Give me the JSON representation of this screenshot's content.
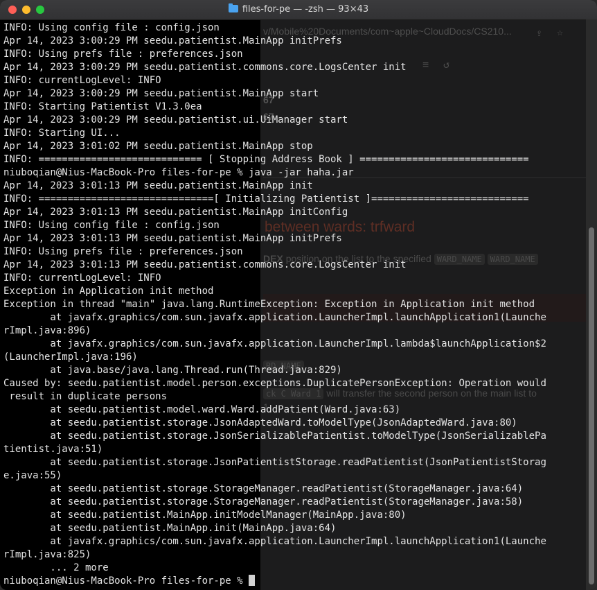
{
  "window": {
    "title": "files-for-pe — -zsh — 93×43"
  },
  "background_window": {
    "url_fragment": "v/Mobile%20Documents/com~apple~CloudDocs/CS210...",
    "number_1": "67",
    "number_2": "67",
    "heading": "between wards: trfward",
    "body_1_prefix": "DEX",
    "body_1_text": "position on the list to the specified",
    "code_1": "WARD_NAME",
    "code_2": "WARD_NAME",
    "code_3": "RD_NAME",
    "code_4": "ck C Ward 1",
    "body_2_text": "will transfer the second person on the main list to",
    "body_3_text": "1"
  },
  "terminal": {
    "lines": [
      "INFO: Using config file : config.json",
      "Apr 14, 2023 3:00:29 PM seedu.patientist.MainApp initPrefs",
      "INFO: Using prefs file : preferences.json",
      "Apr 14, 2023 3:00:29 PM seedu.patientist.commons.core.LogsCenter init",
      "INFO: currentLogLevel: INFO",
      "Apr 14, 2023 3:00:29 PM seedu.patientist.MainApp start",
      "INFO: Starting Patientist V1.3.0ea",
      "Apr 14, 2023 3:00:29 PM seedu.patientist.ui.UiManager start",
      "INFO: Starting UI...",
      "Apr 14, 2023 3:01:02 PM seedu.patientist.MainApp stop",
      "INFO: ============================ [ Stopping Address Book ] =============================",
      "niuboqian@Nius-MacBook-Pro files-for-pe % java -jar haha.jar",
      "Apr 14, 2023 3:01:13 PM seedu.patientist.MainApp init",
      "INFO: ==============================[ Initializing Patientist ]===========================",
      "Apr 14, 2023 3:01:13 PM seedu.patientist.MainApp initConfig",
      "INFO: Using config file : config.json",
      "Apr 14, 2023 3:01:13 PM seedu.patientist.MainApp initPrefs",
      "INFO: Using prefs file : preferences.json",
      "Apr 14, 2023 3:01:13 PM seedu.patientist.commons.core.LogsCenter init",
      "INFO: currentLogLevel: INFO",
      "Exception in Application init method",
      "Exception in thread \"main\" java.lang.RuntimeException: Exception in Application init method",
      "        at javafx.graphics/com.sun.javafx.application.LauncherImpl.launchApplication1(Launche",
      "rImpl.java:896)",
      "        at javafx.graphics/com.sun.javafx.application.LauncherImpl.lambda$launchApplication$2",
      "(LauncherImpl.java:196)",
      "        at java.base/java.lang.Thread.run(Thread.java:829)",
      "Caused by: seedu.patientist.model.person.exceptions.DuplicatePersonException: Operation would",
      " result in duplicate persons",
      "        at seedu.patientist.model.ward.Ward.addPatient(Ward.java:63)",
      "        at seedu.patientist.storage.JsonAdaptedWard.toModelType(JsonAdaptedWard.java:80)",
      "        at seedu.patientist.storage.JsonSerializablePatientist.toModelType(JsonSerializablePa",
      "tientist.java:51)",
      "        at seedu.patientist.storage.JsonPatientistStorage.readPatientist(JsonPatientistStorag",
      "e.java:55)",
      "        at seedu.patientist.storage.StorageManager.readPatientist(StorageManager.java:64)",
      "        at seedu.patientist.storage.StorageManager.readPatientist(StorageManager.java:58)",
      "        at seedu.patientist.MainApp.initModelManager(MainApp.java:80)",
      "        at seedu.patientist.MainApp.init(MainApp.java:64)",
      "        at javafx.graphics/com.sun.javafx.application.LauncherImpl.launchApplication1(Launche",
      "rImpl.java:825)",
      "        ... 2 more"
    ],
    "prompt": "niuboqian@Nius-MacBook-Pro files-for-pe % "
  },
  "colors": {
    "terminal_bg": "#000000",
    "terminal_fg": "#e4e4e4",
    "close": "#ff5f57",
    "minimize": "#febc2e",
    "maximize": "#28c840"
  }
}
